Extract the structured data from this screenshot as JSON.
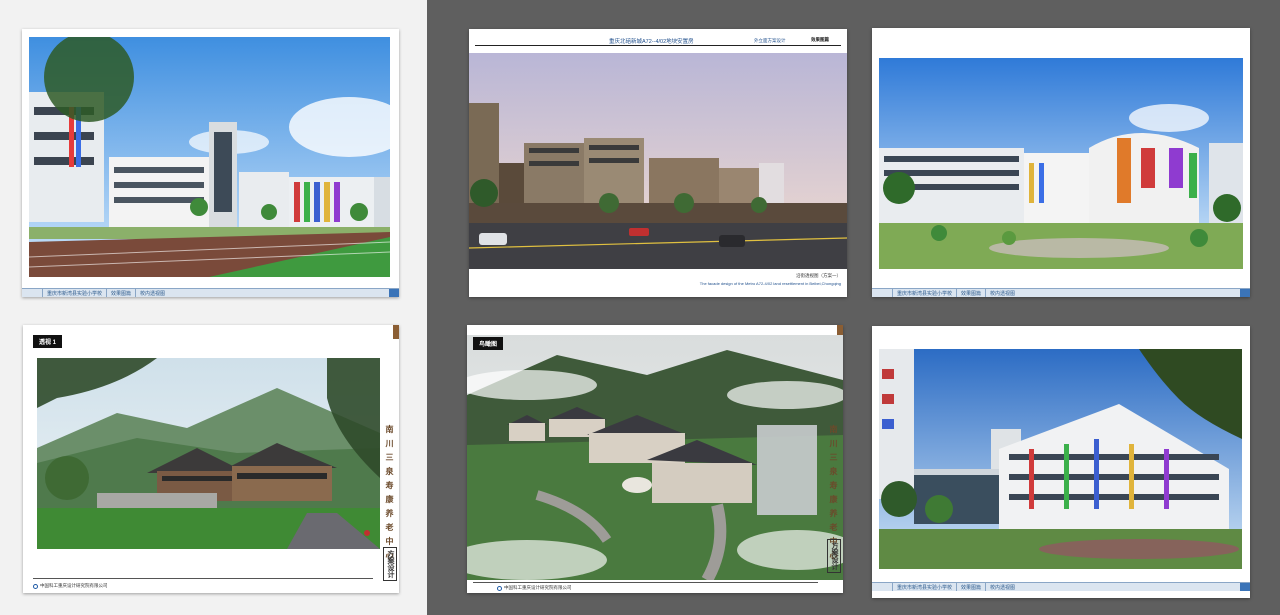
{
  "sheets": {
    "s1": {
      "footer": [
        "重庆市新湾县实验小学校",
        "效果图篇",
        "校内透视图"
      ]
    },
    "s2": {
      "title": "重庆北碚新城A72--4/02地块安置房",
      "subtitle": "外立面方案设计",
      "section": "效果图篇",
      "caption": "沿街透视图（方案一）",
      "caption_en": "The facade design of the Metro A72-4/02 land resettlement in Beibei,Chongqing"
    },
    "s3": {
      "footer": [
        "重庆市新湾县实验小学校",
        "效果图篇",
        "校内透视图"
      ]
    },
    "s4": {
      "tag": "透视 1",
      "vertical_title": "南川三泉寿康养老中心",
      "vertical_box": "方案设计",
      "company": "中国科工重庆设计研究院有限公司"
    },
    "s5": {
      "tag": "鸟瞰图",
      "vertical_title": "南川三泉寿康养老中心",
      "vertical_box": "方案设计",
      "company": "中国科工重庆设计研究院有限公司"
    },
    "s6": {
      "footer": [
        "重庆市新湾县实验小学校",
        "效果图篇",
        "校内透视图"
      ]
    }
  },
  "colors": {
    "left_panel_bg": "#f2f2f2",
    "right_panel_bg": "#5f5f5f",
    "footer_bg": "#dbe5f0",
    "footer_text": "#2c5a8c",
    "accent_blue": "#3b74b8",
    "accent_brown": "#8b5e34"
  }
}
